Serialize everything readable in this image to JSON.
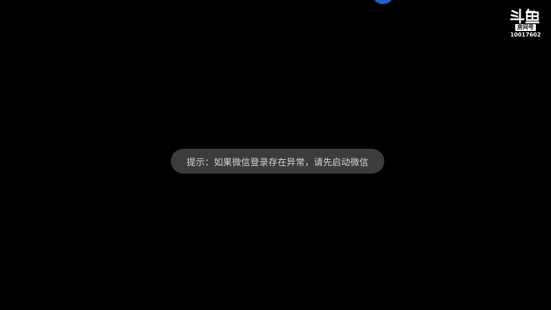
{
  "toast": {
    "message": "提示：如果微信登录存在异常，请先启动微信"
  },
  "watermark": {
    "logo_text": "斗鱼",
    "room_label": "房间号",
    "room_number": "10017602"
  },
  "colors": {
    "background": "#000000",
    "toast_background": "#3c3c3c",
    "toast_text": "#d6d6d6",
    "top_indicator": "#1f62c4"
  }
}
